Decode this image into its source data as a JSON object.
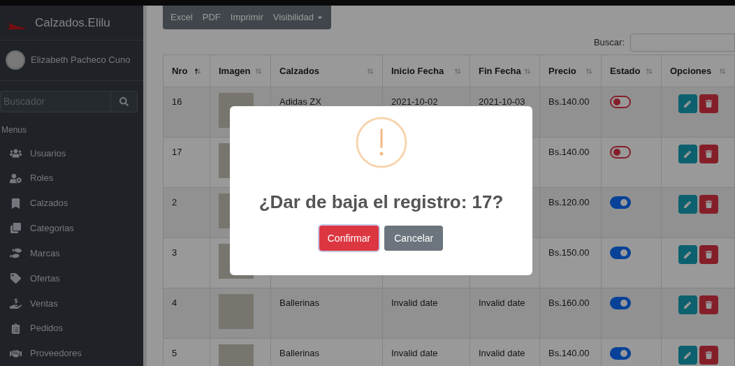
{
  "sidebar": {
    "brand": "Calzados.Elilu",
    "user": "Elizabeth Pacheco Cuno",
    "search": {
      "placeholder": "Buscador"
    },
    "section": "Menus",
    "items": [
      {
        "label": "Usuarios"
      },
      {
        "label": "Roles"
      },
      {
        "label": "Calzados"
      },
      {
        "label": "Categorias"
      },
      {
        "label": "Marcas"
      },
      {
        "label": "Ofertas"
      },
      {
        "label": "Ventas"
      },
      {
        "label": "Pedidos"
      },
      {
        "label": "Proveedores"
      }
    ]
  },
  "toolbar": {
    "buttons": [
      {
        "label": "Excel",
        "kind": "plain"
      },
      {
        "label": "PDF",
        "kind": "plain"
      },
      {
        "label": "Imprimir",
        "kind": "plain"
      },
      {
        "label": "Visibilidad",
        "kind": "dropdown"
      }
    ],
    "search_label": "Buscar:"
  },
  "table": {
    "columns": [
      {
        "label": "Nro",
        "sorted": true
      },
      {
        "label": "Imagen",
        "sorted": false
      },
      {
        "label": "Calzados",
        "sorted": false
      },
      {
        "label": "Inicio Fecha",
        "sorted": false
      },
      {
        "label": "Fin Fecha",
        "sorted": false
      },
      {
        "label": "Precio",
        "sorted": false
      },
      {
        "label": "Estado",
        "sorted": false
      },
      {
        "label": "Opciones",
        "sorted": false
      }
    ],
    "rows": [
      {
        "nro": "16",
        "calzado": "Adidas ZX",
        "inicio": "2021-10-02",
        "fin": "2021-10-03",
        "precio": "Bs.140.00",
        "on": false
      },
      {
        "nro": "17",
        "precio": "Bs.140.00",
        "on": false
      },
      {
        "nro": "2",
        "precio": "Bs.120.00",
        "on": true
      },
      {
        "nro": "3",
        "precio": "Bs.150.00",
        "on": true
      },
      {
        "nro": "4",
        "calzado": "Ballerinas",
        "inicio": "Invalid date",
        "fin": "Invalid date",
        "precio": "Bs.160.00",
        "on": true
      },
      {
        "nro": "5",
        "calzado": "Ballerinas",
        "inicio": "Invalid date",
        "fin": "Invalid date",
        "precio": "Bs.140.00",
        "on": true
      }
    ]
  },
  "modal": {
    "title": "¿Dar de baja el registro: 17?",
    "confirm": "Confirmar",
    "cancel": "Cancelar"
  }
}
